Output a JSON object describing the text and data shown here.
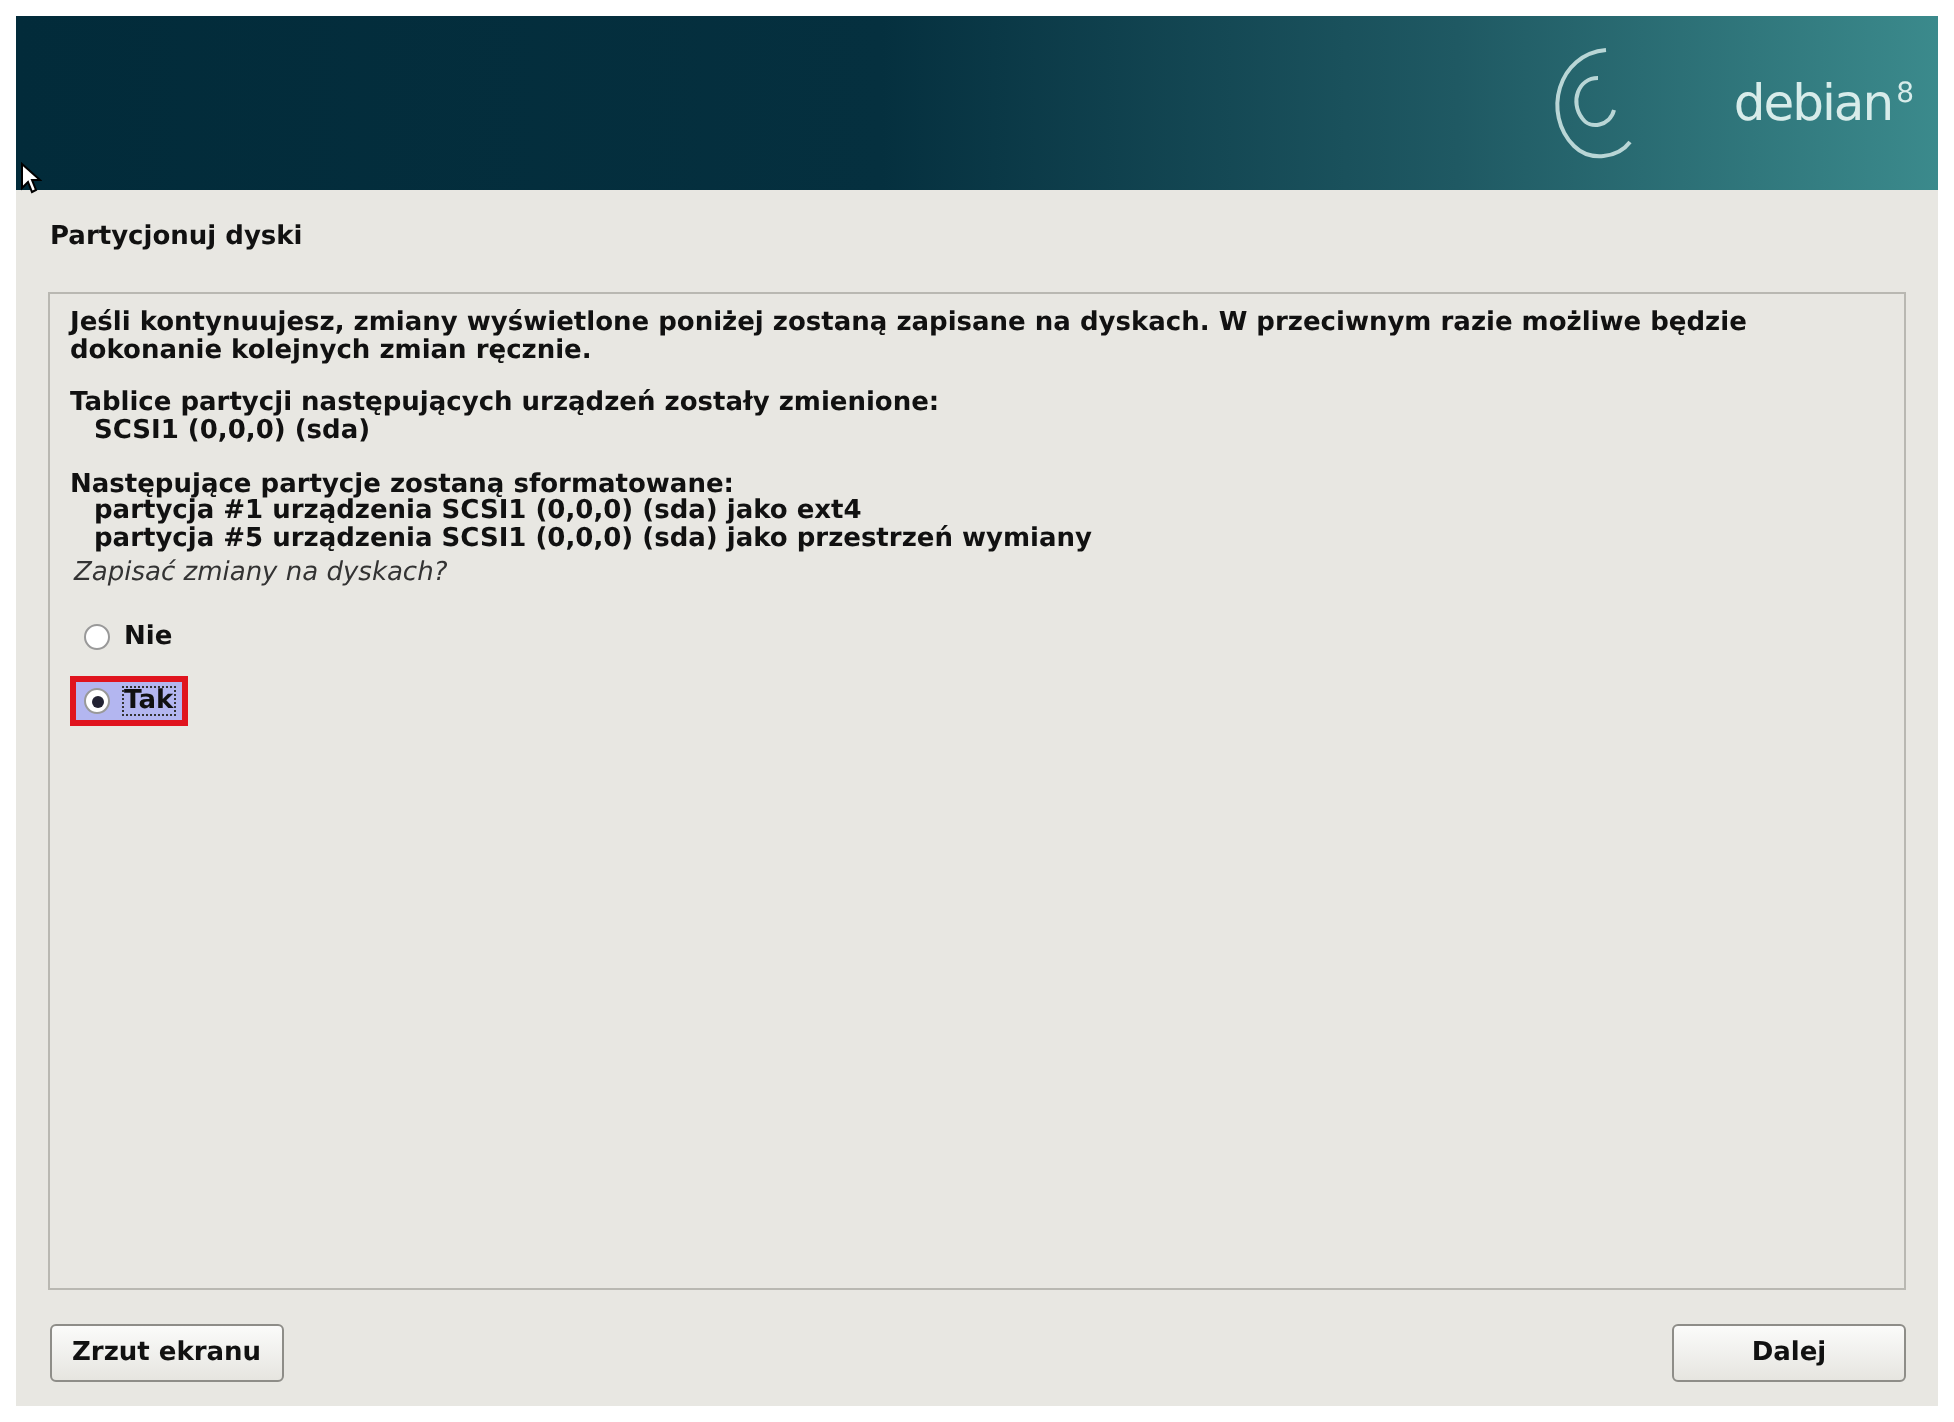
{
  "banner": {
    "logo_text": "debian",
    "version": "8"
  },
  "title": "Partycjonuj dyski",
  "message": [
    {
      "kind": "paragraph",
      "text": "Jeśli kontynuujesz, zmiany wyświetlone poniżej zostaną zapisane na dyskach. W przeciwnym razie możliwe będzie dokonanie kolejnych zmian ręcznie."
    },
    {
      "kind": "list",
      "heading": "Tablice partycji następujących urządzeń zostały zmienione:",
      "items": [
        "SCSI1 (0,0,0) (sda)"
      ]
    },
    {
      "kind": "list",
      "heading": "Następujące partycje zostaną sformatowane:",
      "items": [
        "partycja #1 urządzenia SCSI1 (0,0,0) (sda) jako ext4",
        "partycja #5 urządzenia SCSI1 (0,0,0) (sda) jako przestrzeń wymiany"
      ]
    }
  ],
  "question": "Zapisać zmiany na dyskach?",
  "options": [
    {
      "label": "Nie",
      "selected": false
    },
    {
      "label": "Tak",
      "selected": true
    }
  ],
  "buttons": [
    {
      "label": "Zrzut ekranu"
    },
    {
      "label": "Dalej"
    }
  ]
}
